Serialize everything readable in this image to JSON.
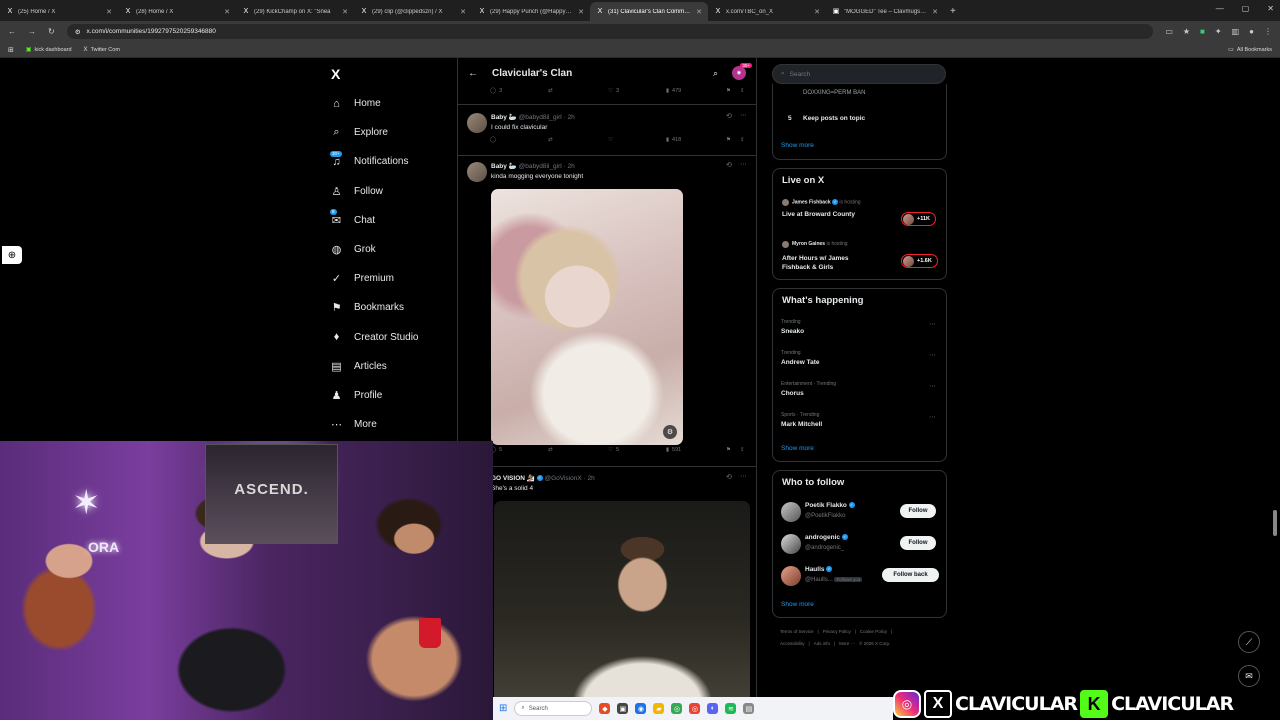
{
  "browser": {
    "tabs": [
      {
        "title": "(25) Home / X",
        "favicon": "X"
      },
      {
        "title": "(28) Home / X",
        "favicon": "X"
      },
      {
        "title": "(29) KickChamp on X: \"Snea",
        "favicon": "X"
      },
      {
        "title": "(29) clip (@clippedszn) / X",
        "favicon": "X"
      },
      {
        "title": "(29) Happy Punch (@HappyPun",
        "favicon": "X"
      },
      {
        "title": "(31) Clavicular's Clan Communi",
        "favicon": "X",
        "active": true
      },
      {
        "title": "x.com/TBC_on_X",
        "favicon": "X"
      },
      {
        "title": "\"MOGGED\" Tee – Clavmugshot",
        "favicon": "▣"
      }
    ],
    "new_tab": "+",
    "url": "x.com/i/communities/1992797520259346880",
    "bookmarks": [
      {
        "label": "kick dashboard",
        "icon": "kick-icon"
      },
      {
        "label": "Twitter Com",
        "icon": "x-icon"
      }
    ],
    "all_bookmarks": "All Bookmarks"
  },
  "leftnav": {
    "logo": "X",
    "items": [
      {
        "label": "Home",
        "icon": "⌂"
      },
      {
        "label": "Explore",
        "icon": "⌕"
      },
      {
        "label": "Notifications",
        "icon": "♫",
        "badge": "30+"
      },
      {
        "label": "Follow",
        "icon": "♙"
      },
      {
        "label": "Chat",
        "icon": "✉",
        "badge": "8"
      },
      {
        "label": "Grok",
        "icon": "◍"
      },
      {
        "label": "Premium",
        "icon": "✓"
      },
      {
        "label": "Bookmarks",
        "icon": "⚑"
      },
      {
        "label": "Creator Studio",
        "icon": "♦"
      },
      {
        "label": "Articles",
        "icon": "▤"
      },
      {
        "label": "Profile",
        "icon": "♟"
      },
      {
        "label": "More",
        "icon": "⋯"
      }
    ]
  },
  "community": {
    "title": "Clavicular's Clan",
    "avatar_count": "30+"
  },
  "posts": [
    {
      "stats": {
        "replies": "3",
        "reposts": "",
        "likes": "3",
        "views": "479"
      }
    },
    {
      "name": "Baby 🦢",
      "handle": "@babyd8il_girl · 2h",
      "text": "I could fix clavicular",
      "stats": {
        "replies": "",
        "reposts": "",
        "likes": "",
        "views": "418"
      }
    },
    {
      "name": "Baby 🦢",
      "handle": "@babyd8il_girl · 2h",
      "text": "kinda mogging everyone tonight",
      "stats": {
        "replies": "5",
        "reposts": "",
        "likes": "5",
        "views": "591"
      }
    },
    {
      "name": "GO VISION 🏂",
      "handle": "@GoVisionX · 2h",
      "text": "She's a solid 4"
    }
  ],
  "right": {
    "search_placeholder": "Search",
    "rules": {
      "rule4_tail": "DOXXING=PERM BAN",
      "rule5_num": "5",
      "rule5_text": "Keep posts on topic",
      "show_more": "Show more"
    },
    "live": {
      "title": "Live on X",
      "items": [
        {
          "host": "James Fishback",
          "status": "is hosting",
          "title": "Live at Broward County",
          "count": "+11K"
        },
        {
          "host": "Myron Gaines",
          "status": "is hosting",
          "title": "After Hours w/ James Fishback & Girls",
          "count": "+1.6K"
        }
      ]
    },
    "happening": {
      "title": "What's happening",
      "items": [
        {
          "context": "Trending",
          "topic": "Sneako"
        },
        {
          "context": "Trending",
          "topic": "Andrew Tate"
        },
        {
          "context": "Entertainment · Trending",
          "topic": "Chorus"
        },
        {
          "context": "Sports · Trending",
          "topic": "Mark Mitchell"
        }
      ],
      "show_more": "Show more"
    },
    "who_to_follow": {
      "title": "Who to follow",
      "items": [
        {
          "name": "Poetik Flakko",
          "handle": "@PoetikFlakko",
          "button": "Follow"
        },
        {
          "name": "androgenic",
          "handle": "@androgenic_",
          "button": "Follow"
        },
        {
          "name": "Haulls",
          "handle": "@Haulls...",
          "follows_you": "Follows you",
          "button": "Follow back"
        }
      ],
      "show_more": "Show more"
    },
    "footer": {
      "line1": [
        "Terms of Service",
        "|",
        "Privacy Policy",
        "|",
        "Cookie Policy",
        "|"
      ],
      "line2": [
        "Accessibility",
        "|",
        "Ads info",
        "|",
        "More ···",
        "© 2026 X Corp."
      ]
    }
  },
  "overlay": {
    "poster_text": "ASCEND.",
    "neon_text": "ORA",
    "taskbar_search": "Search",
    "banner_text1": "CLAVICULAR",
    "banner_text2": "CLAVICULAR"
  }
}
